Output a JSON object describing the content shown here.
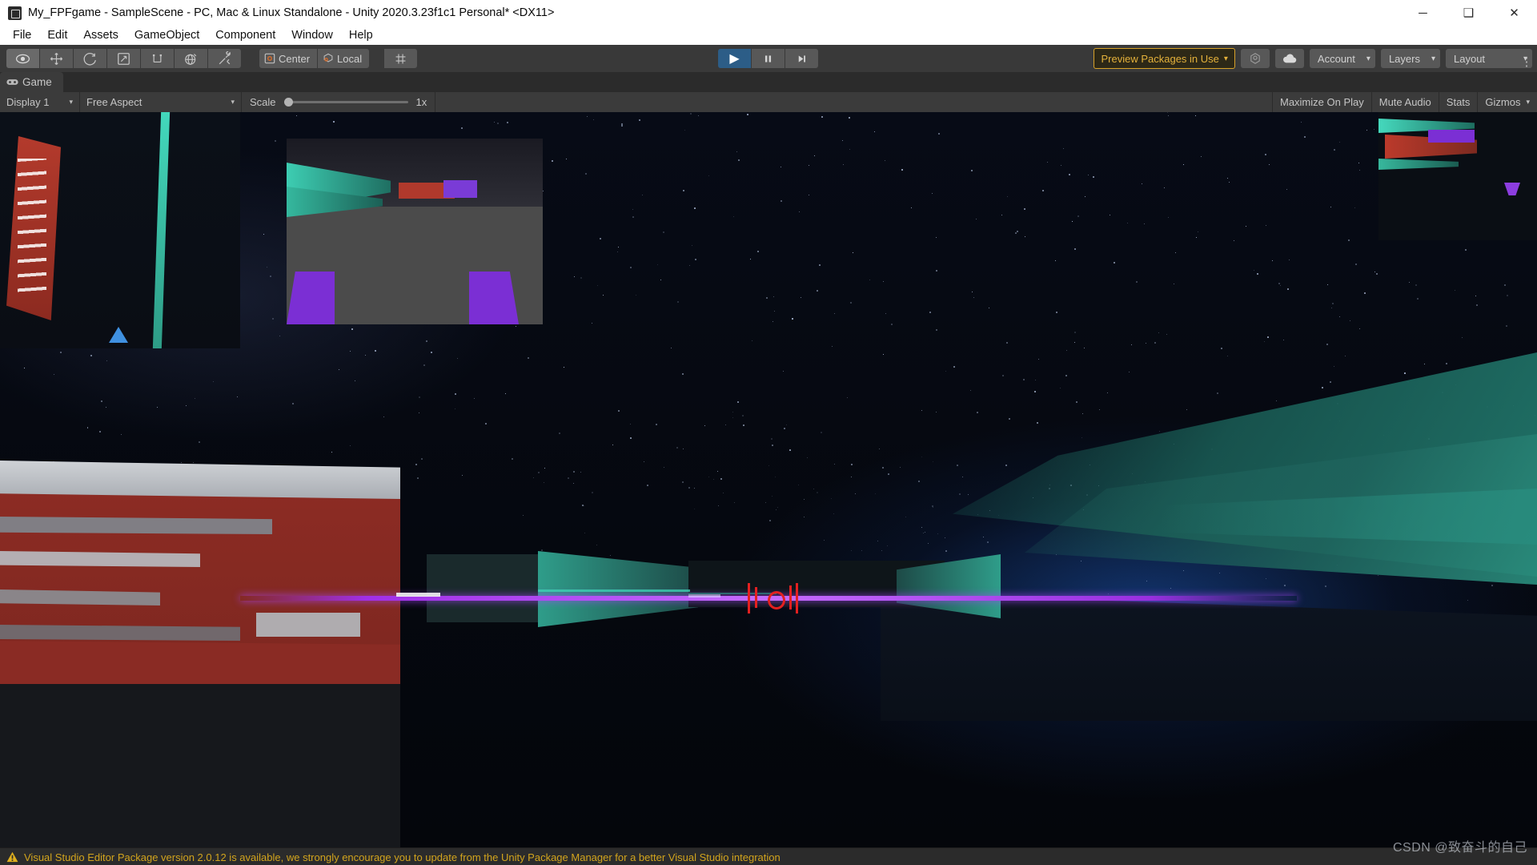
{
  "window": {
    "title": "My_FPFgame - SampleScene - PC, Mac & Linux Standalone - Unity 2020.3.23f1c1 Personal* <DX11>",
    "app_icon": "unity-icon",
    "minimize_label": "─",
    "maximize_label": "❑",
    "close_label": "✕"
  },
  "menubar": {
    "items": [
      {
        "label": "File"
      },
      {
        "label": "Edit"
      },
      {
        "label": "Assets"
      },
      {
        "label": "GameObject"
      },
      {
        "label": "Component"
      },
      {
        "label": "Window"
      },
      {
        "label": "Help"
      }
    ]
  },
  "toolbar": {
    "tools": [
      {
        "name": "hand-tool",
        "icon": "eye-icon",
        "selected": true
      },
      {
        "name": "move-tool",
        "icon": "move-arrows-icon",
        "selected": false
      },
      {
        "name": "rotate-tool",
        "icon": "rotate-icon",
        "selected": false
      },
      {
        "name": "scale-tool",
        "icon": "scale-icon",
        "selected": false
      },
      {
        "name": "rect-tool",
        "icon": "rect-transform-icon",
        "selected": false
      },
      {
        "name": "transform-tool",
        "icon": "global-transform-icon",
        "selected": false
      },
      {
        "name": "custom-tool",
        "icon": "wrench-icon",
        "selected": false
      }
    ],
    "pivot_label": "Center",
    "pivot_icon": "pivot-center-icon",
    "handle_label": "Local",
    "handle_icon": "handle-local-icon",
    "snap_icon": "grid-snap-icon",
    "play_label": "▶",
    "pause_label": "▐▌",
    "step_label": "▶|",
    "play_active": true,
    "preview_packages_label": "Preview Packages in Use",
    "preview_packages_caret": "▾",
    "collab_icon": "collab-icon",
    "cloud_icon": "cloud-icon",
    "account_label": "Account",
    "account_caret": "▾",
    "layers_label": "Layers",
    "layers_caret": "▾",
    "layout_label": "Layout",
    "layout_caret": "▾",
    "kebab_label": "⋮"
  },
  "tabs": {
    "game": {
      "label": "Game",
      "icon": "gamepad-icon",
      "active": true
    }
  },
  "gamebar": {
    "display": {
      "label": "Display 1",
      "caret": "▾"
    },
    "aspect": {
      "label": "Free Aspect",
      "caret": "▾"
    },
    "scale": {
      "label": "Scale",
      "value": "1x",
      "slider_percent": 0
    },
    "maximize_on_play": "Maximize On Play",
    "mute_audio": "Mute Audio",
    "stats": "Stats",
    "gizmos": {
      "label": "Gizmos",
      "caret": "▾"
    }
  },
  "game": {
    "hud_crosshair": "|| o ||",
    "accent_red": "#e32020",
    "accent_purple": "#8a2be2",
    "accent_teal": "#2fb39a",
    "accent_brick": "#8a2b26"
  },
  "statusbar": {
    "warning_icon": "warning-triangle-icon",
    "message": "Visual Studio Editor Package version 2.0.12 is available, we strongly encourage you to update from the Unity Package Manager for a better Visual Studio integration",
    "color": "#d2a41d"
  },
  "watermark": {
    "text": "CSDN @致奋斗的自己"
  }
}
